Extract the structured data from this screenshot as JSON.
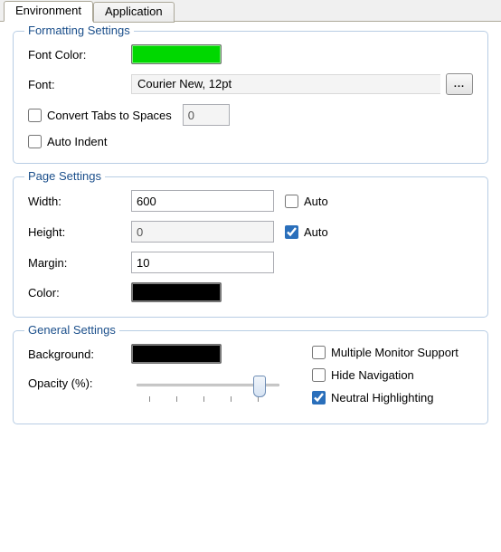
{
  "tabs": {
    "environment": "Environment",
    "application": "Application"
  },
  "formatting": {
    "legend": "Formatting Settings",
    "fontColorLabel": "Font Color:",
    "fontColorHex": "#00d800",
    "fontLabel": "Font:",
    "fontDisplay": "Courier New, 12pt",
    "browse": "...",
    "convertTabsLabel": "Convert Tabs to Spaces",
    "convertTabsChecked": false,
    "convertTabsValue": "0",
    "autoIndentLabel": "Auto Indent",
    "autoIndentChecked": false
  },
  "page": {
    "legend": "Page Settings",
    "widthLabel": "Width:",
    "widthValue": "600",
    "widthAutoLabel": "Auto",
    "widthAutoChecked": false,
    "heightLabel": "Height:",
    "heightValue": "0",
    "heightAutoLabel": "Auto",
    "heightAutoChecked": true,
    "marginLabel": "Margin:",
    "marginValue": "10",
    "colorLabel": "Color:",
    "colorHex": "#000000"
  },
  "general": {
    "legend": "General Settings",
    "backgroundLabel": "Background:",
    "backgroundHex": "#000000",
    "opacityLabel": "Opacity (%):",
    "opacityValue": 85,
    "multiMonitorLabel": "Multiple Monitor Support",
    "multiMonitorChecked": false,
    "hideNavLabel": "Hide Navigation",
    "hideNavChecked": false,
    "neutralHlLabel": "Neutral Highlighting",
    "neutralHlChecked": true
  }
}
